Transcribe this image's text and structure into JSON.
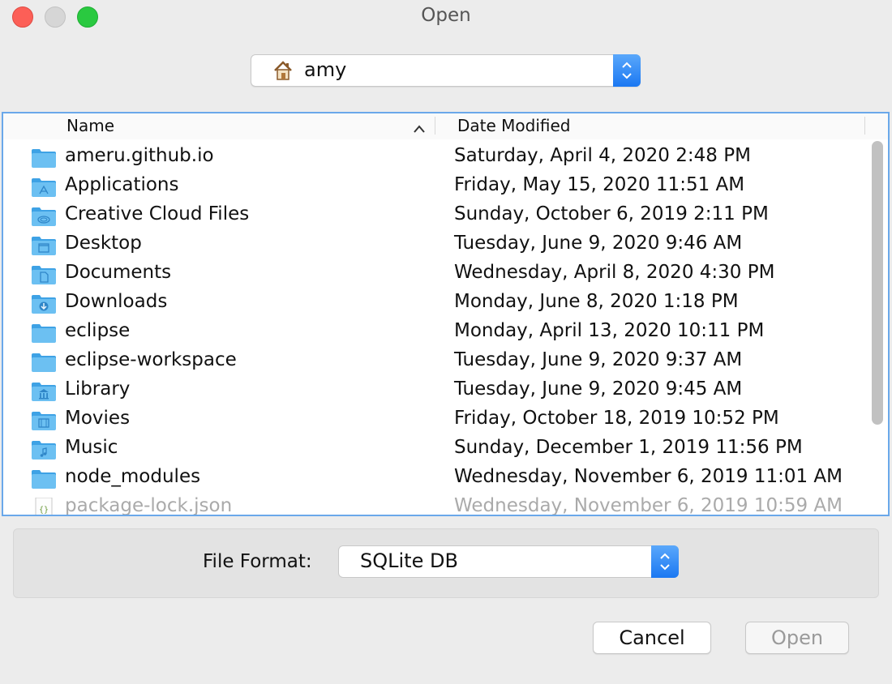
{
  "window": {
    "title": "Open"
  },
  "location": {
    "label": "amy",
    "icon": "home-icon"
  },
  "columns": {
    "name": "Name",
    "date": "Date Modified"
  },
  "files": [
    {
      "name": "ameru.github.io",
      "date": "Saturday, April 4, 2020 2:48 PM",
      "icon": "folder-icon"
    },
    {
      "name": "Applications",
      "date": "Friday, May 15, 2020 11:51 AM",
      "icon": "applications-folder-icon"
    },
    {
      "name": "Creative Cloud Files",
      "date": "Sunday, October 6, 2019 2:11 PM",
      "icon": "creative-cloud-folder-icon"
    },
    {
      "name": "Desktop",
      "date": "Tuesday, June 9, 2020 9:46 AM",
      "icon": "desktop-folder-icon"
    },
    {
      "name": "Documents",
      "date": "Wednesday, April 8, 2020 4:30 PM",
      "icon": "documents-folder-icon"
    },
    {
      "name": "Downloads",
      "date": "Monday, June 8, 2020 1:18 PM",
      "icon": "downloads-folder-icon"
    },
    {
      "name": "eclipse",
      "date": "Monday, April 13, 2020 10:11 PM",
      "icon": "folder-icon"
    },
    {
      "name": "eclipse-workspace",
      "date": "Tuesday, June 9, 2020 9:37 AM",
      "icon": "folder-icon"
    },
    {
      "name": "Library",
      "date": "Tuesday, June 9, 2020 9:45 AM",
      "icon": "library-folder-icon"
    },
    {
      "name": "Movies",
      "date": "Friday, October 18, 2019 10:52 PM",
      "icon": "movies-folder-icon"
    },
    {
      "name": "Music",
      "date": "Sunday, December 1, 2019 11:56 PM",
      "icon": "music-folder-icon"
    },
    {
      "name": "node_modules",
      "date": "Wednesday, November 6, 2019 11:01 AM",
      "icon": "folder-icon"
    },
    {
      "name": "package-lock.json",
      "date": "Wednesday, November 6, 2019 10:59 AM",
      "icon": "json-file-icon"
    }
  ],
  "format": {
    "label": "File Format:",
    "value": "SQLite DB"
  },
  "buttons": {
    "cancel": "Cancel",
    "open": "Open"
  },
  "colors": {
    "accent": "#1b78f2",
    "folder": "#5fb5ee",
    "close": "#fc5f57",
    "maximize": "#2ac940"
  }
}
